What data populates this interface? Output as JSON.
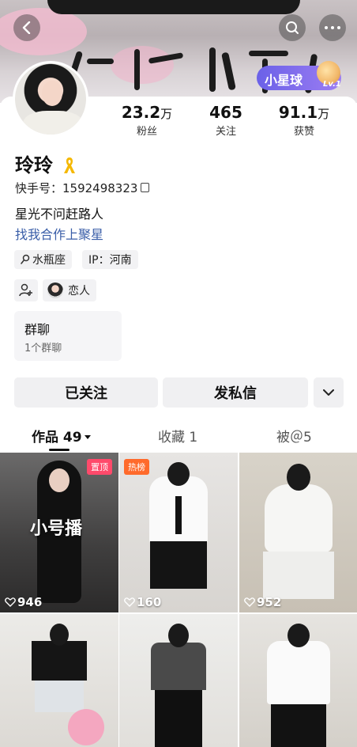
{
  "header": {
    "planet_label": "小星球",
    "planet_level": "Lv.1"
  },
  "profile": {
    "name": "玲玲",
    "uid": "快手号：1592498323",
    "bio": "星光不问赶路人",
    "bio_link": "找我合作上聚星",
    "tags": {
      "zodiac": "水瓶座",
      "ip": "IP：河南",
      "lover": "恋人"
    }
  },
  "stats": [
    {
      "value": "23.2",
      "unit": "万",
      "label": "粉丝"
    },
    {
      "value": "465",
      "unit": "",
      "label": "关注"
    },
    {
      "value": "91.1",
      "unit": "万",
      "label": "获赞"
    }
  ],
  "group_chat": {
    "title": "群聊",
    "subtitle": "1个群聊"
  },
  "actions": {
    "follow": "已关注",
    "message": "发私信"
  },
  "tabs": {
    "works": "作品 49",
    "favorites": "收藏 1",
    "mentions": "被＠5"
  },
  "videos": [
    {
      "likes": "946",
      "badge": "置顶",
      "overlay": "小号播"
    },
    {
      "likes": "160",
      "badge": "热榜",
      "overlay": ""
    },
    {
      "likes": "952",
      "badge": "",
      "overlay": ""
    },
    {
      "likes": "",
      "badge": "",
      "overlay": ""
    },
    {
      "likes": "",
      "badge": "",
      "overlay": ""
    },
    {
      "likes": "",
      "badge": "",
      "overlay": ""
    }
  ],
  "colors": {
    "planet": "#7a6cec",
    "link": "#3a5ea8",
    "pin_badge": "#ff4a6b",
    "hot_badge": "#ff6a2b"
  },
  "icons": [
    "back-icon",
    "search-icon",
    "more-icon",
    "ribbon-icon",
    "copy-icon",
    "location-icon",
    "add-friend-icon",
    "chevron-down-icon",
    "heart-icon"
  ]
}
